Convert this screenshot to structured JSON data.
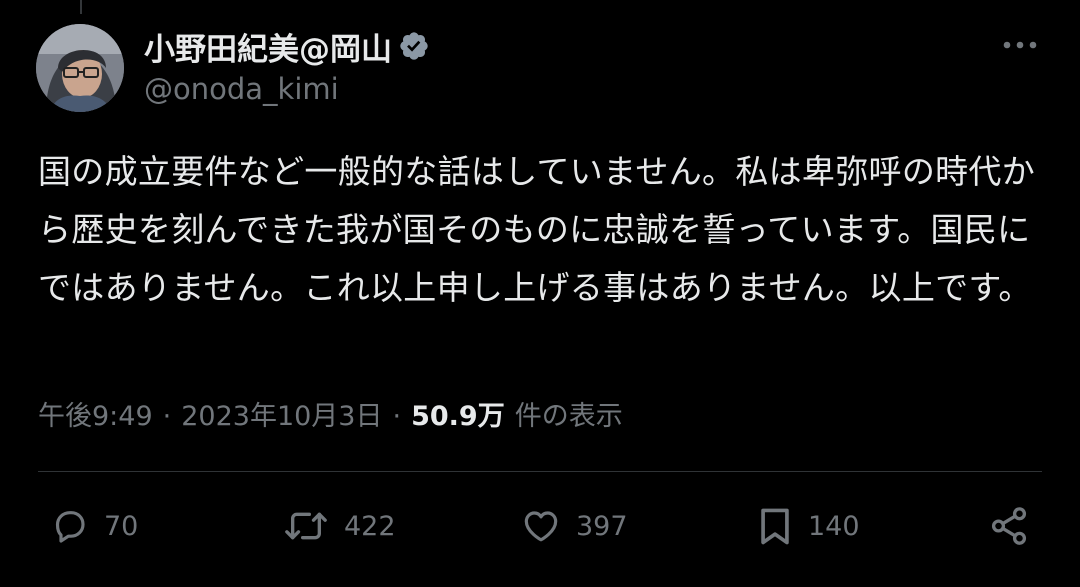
{
  "author": {
    "display_name": "小野田紀美@岡山",
    "handle": "@onoda_kimi",
    "verified_icon": "verified-badge-icon",
    "verified_color": "#8b98a5"
  },
  "tweet": {
    "text": "国の成立要件など一般的な話はしていません。私は卑弥呼の時代から歴史を刻んできた我が国そのものに忠誠を誓っています。国民にではありません。これ以上申し上げる事はありません。以上です。"
  },
  "meta": {
    "time": "午後9:49",
    "separator": "·",
    "date": "2023年10月3日",
    "views_count": "50.9万",
    "views_label": "件の表示"
  },
  "actions": {
    "reply": {
      "icon": "reply-icon",
      "count": "70"
    },
    "retweet": {
      "icon": "retweet-icon",
      "count": "422"
    },
    "like": {
      "icon": "heart-icon",
      "count": "397"
    },
    "bookmark": {
      "icon": "bookmark-icon",
      "count": "140"
    },
    "share": {
      "icon": "share-icon"
    }
  },
  "colors": {
    "background": "#000000",
    "primary_text": "#e7e9ea",
    "secondary_text": "#71767b",
    "divider": "#2f3336"
  }
}
